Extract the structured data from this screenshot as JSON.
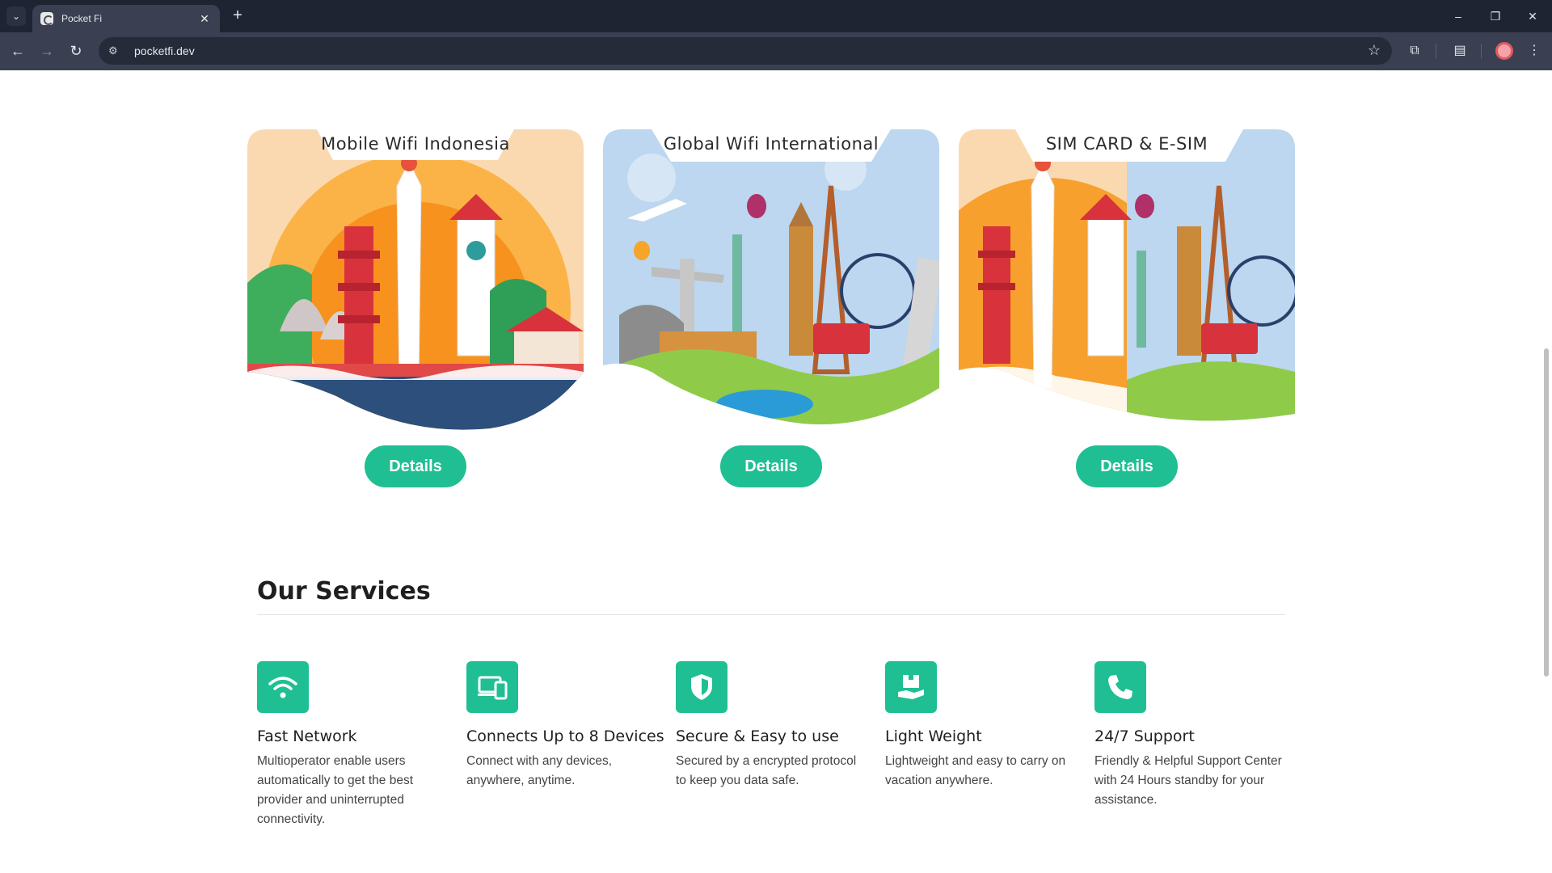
{
  "browser": {
    "tab_title": "Pocket Fi",
    "url": "pocketfi.dev"
  },
  "cards": [
    {
      "title": "Mobile Wifi Indonesia",
      "button": "Details"
    },
    {
      "title": "Global Wifi International",
      "button": "Details"
    },
    {
      "title": "SIM CARD & E-SIM",
      "button": "Details"
    }
  ],
  "services": {
    "heading": "Our Services",
    "items": [
      {
        "icon": "wifi-icon",
        "title": "Fast Network",
        "desc": "Multioperator enable users automatically to get the best provider and uninterrupted connectivity."
      },
      {
        "icon": "devices-icon",
        "title": "Connects Up to 8 Devices",
        "desc": "Connect with any devices, anywhere, anytime."
      },
      {
        "icon": "shield-icon",
        "title": "Secure & Easy to use",
        "desc": "Secured by a encrypted protocol to keep you data safe."
      },
      {
        "icon": "package-hand-icon",
        "title": "Light Weight",
        "desc": "Lightweight and easy to carry on vacation anywhere."
      },
      {
        "icon": "phone-icon",
        "title": "24/7 Support",
        "desc": "Friendly & Helpful Support Center with 24 Hours standby for your assistance."
      }
    ]
  },
  "colors": {
    "accent": "#1fbf93",
    "chrome_bg": "#1f2433",
    "toolbar_bg": "#3a4051"
  }
}
